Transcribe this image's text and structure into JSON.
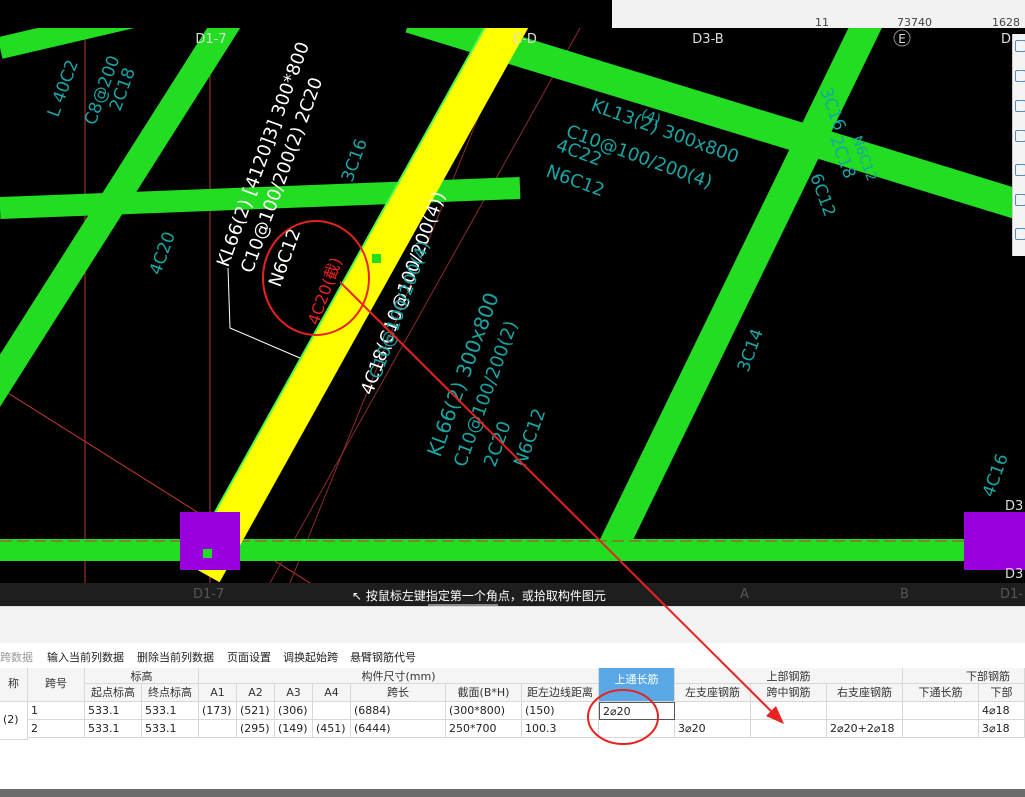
{
  "top_stats": [
    "11",
    "73740",
    "1628"
  ],
  "cad": {
    "axis_labels": [
      "D1-7",
      "C-D",
      "D3-B",
      "E",
      "D"
    ],
    "bottom_axis_labels": [
      "D1-7",
      "A",
      "B",
      "D1-"
    ],
    "edge_labels": [
      "D3",
      "D3"
    ],
    "annotations": [
      "L 40C2",
      "C8@200",
      "2C18",
      "KL66(2) [4120]3] 300*800",
      "C10@100/200(2) 2C20",
      "N6C12",
      "4C20(截)",
      "4C18(C10@100/200(4))",
      "3C16",
      "4C20",
      "KL13(2) 300x800",
      "C10@100/200(4)",
      "4C22",
      "N6C12",
      "3C16",
      "2C18",
      "6C12",
      "C10@100/200(4)",
      "KL66(2) 300x800",
      "C10@100/200(2)",
      "2C20",
      "N6C12",
      "3C14",
      "4C16",
      "(4)",
      "N6C12"
    ]
  },
  "status_prompt": "按鼠标左键指定第一个角点，或拾取构件图元",
  "toolbar": {
    "items": [
      "跨数据",
      "输入当前列数据",
      "删除当前列数据",
      "页面设置",
      "调换起始跨",
      "悬臂钢筋代号"
    ]
  },
  "table": {
    "group_headers": {
      "biaogao": "标高",
      "goujian_size": "构件尺寸(mm)",
      "top_rebar": "上部钢筋",
      "bottom_rebar": "下部钢筋"
    },
    "columns": {
      "name": "称",
      "span_no": "跨号",
      "start_elev": "起点标高",
      "end_elev": "终点标高",
      "a1": "A1",
      "a2": "A2",
      "a3": "A3",
      "a4": "A4",
      "span_len": "跨长",
      "section": "截面(B*H)",
      "left_dist": "距左边线距离",
      "top_through": "上通长筋",
      "left_support": "左支座钢筋",
      "mid_span": "跨中钢筋",
      "right_support": "右支座钢筋",
      "bottom_through": "下通长筋",
      "bottom_part": "下部"
    },
    "rows": [
      {
        "name": "(2)",
        "span_no": "1",
        "start_elev": "533.1",
        "end_elev": "533.1",
        "a1": "(173)",
        "a2": "(521)",
        "a3": "(306)",
        "a4": "",
        "span_len": "(6884)",
        "section": "(300*800)",
        "left_dist": "(150)",
        "top_through": "2⌀20",
        "left_support": "",
        "mid_span": "",
        "right_support": "",
        "bottom_through": "",
        "bottom_part": "4⌀18"
      },
      {
        "name": "",
        "span_no": "2",
        "start_elev": "533.1",
        "end_elev": "533.1",
        "a1": "",
        "a2": "(295)",
        "a3": "(149)",
        "a4": "(451)",
        "span_len": "(6444)",
        "section": "250*700",
        "left_dist": "100.3",
        "top_through": "",
        "left_support": "3⌀20",
        "mid_span": "",
        "right_support": "2⌀20+2⌀18",
        "bottom_through": "",
        "bottom_part": "3⌀18"
      }
    ]
  },
  "colors": {
    "beam_green": "#22dd22",
    "beam_selected": "#ffff00",
    "column_purple": "#9900dd",
    "annotation_cyan": "#1aa5a5",
    "annotation_white": "#ffffff",
    "markup_red": "#e8231f",
    "header_highlight": "#5aa9e6"
  }
}
